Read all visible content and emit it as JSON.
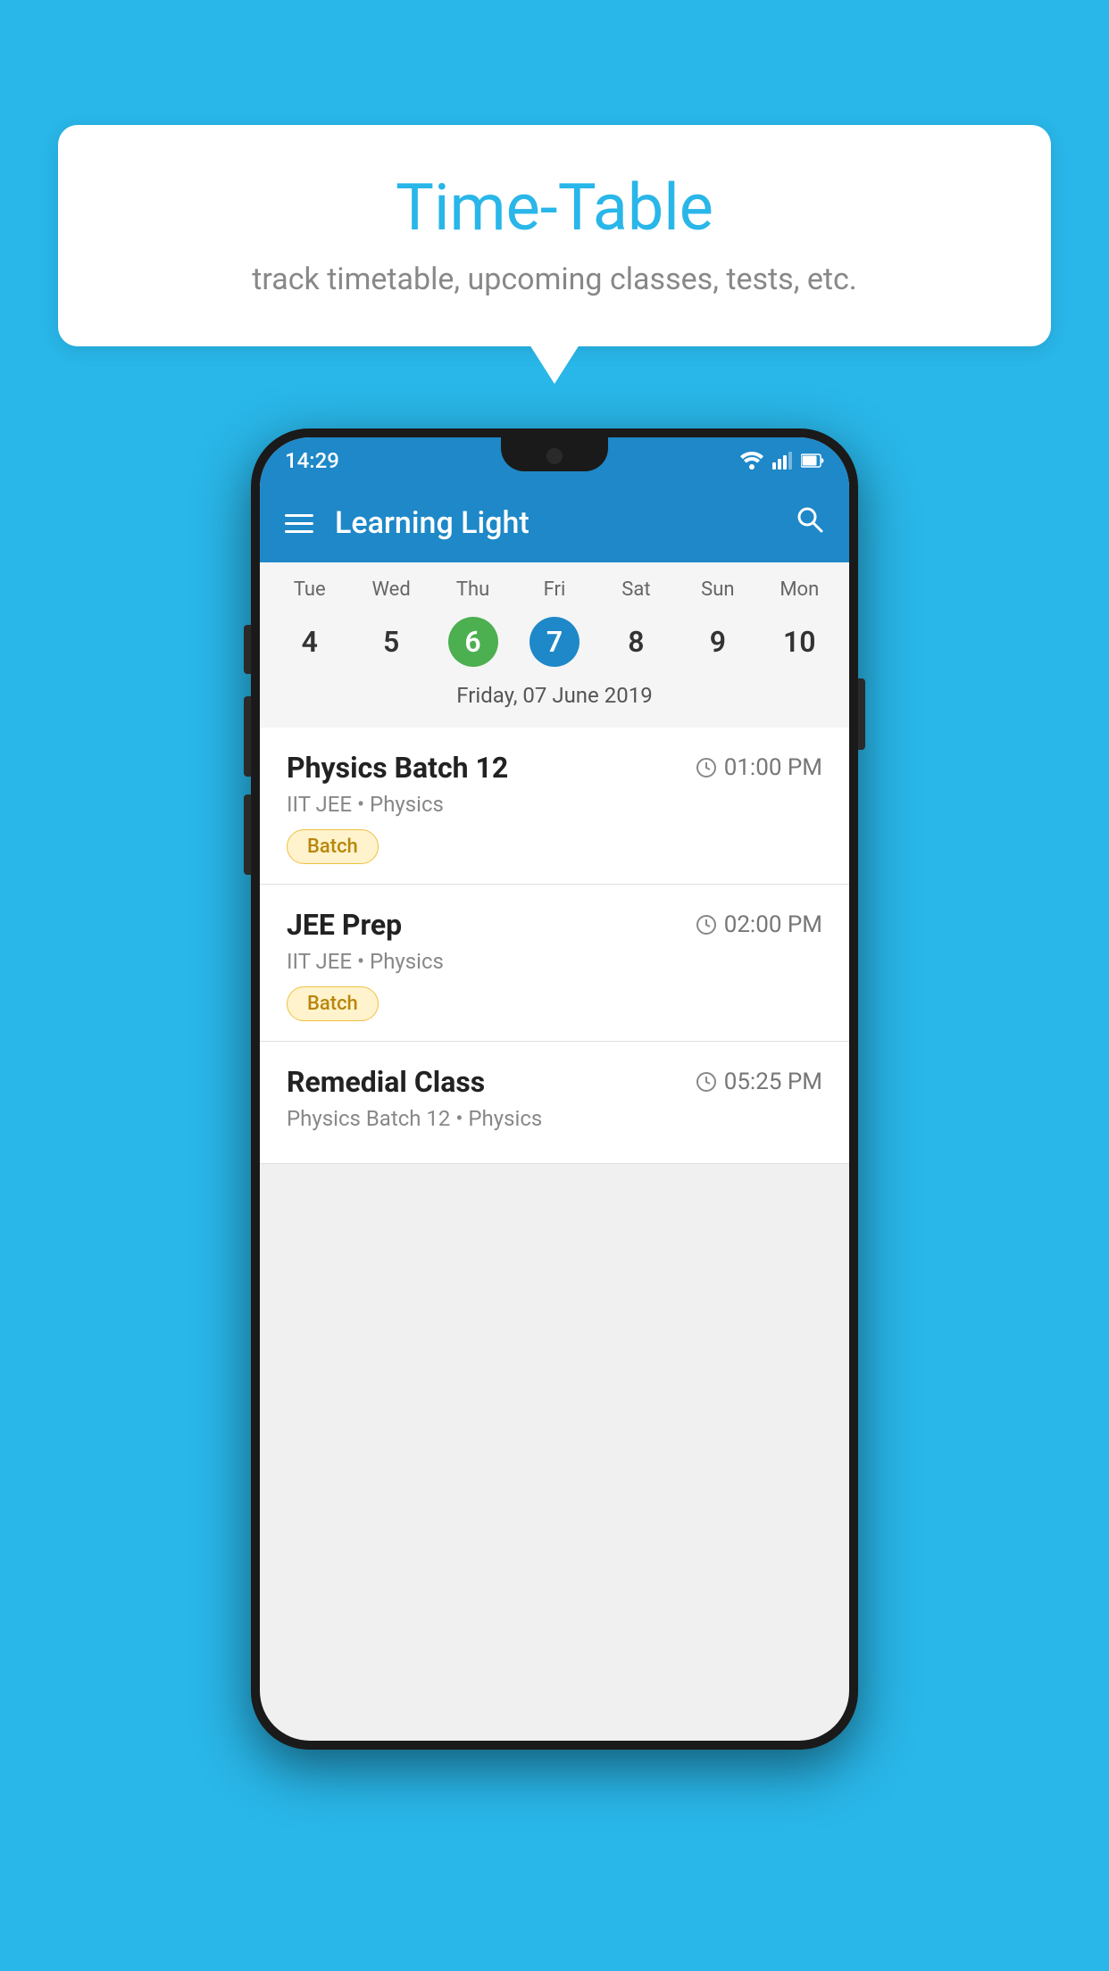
{
  "page": {
    "background_color": "#29b6e8"
  },
  "bubble": {
    "title": "Time-Table",
    "subtitle": "track timetable, upcoming classes, tests, etc."
  },
  "app": {
    "title": "Learning Light"
  },
  "status_bar": {
    "time": "14:29"
  },
  "calendar": {
    "selected_date_label": "Friday, 07 June 2019",
    "days": [
      {
        "name": "Tue",
        "number": "4",
        "state": "normal"
      },
      {
        "name": "Wed",
        "number": "5",
        "state": "normal"
      },
      {
        "name": "Thu",
        "number": "6",
        "state": "today"
      },
      {
        "name": "Fri",
        "number": "7",
        "state": "selected"
      },
      {
        "name": "Sat",
        "number": "8",
        "state": "normal"
      },
      {
        "name": "Sun",
        "number": "9",
        "state": "normal"
      },
      {
        "name": "Mon",
        "number": "10",
        "state": "normal"
      }
    ]
  },
  "schedule_items": [
    {
      "title": "Physics Batch 12",
      "time": "01:00 PM",
      "subtitle": "IIT JEE • Physics",
      "badge": "Batch"
    },
    {
      "title": "JEE Prep",
      "time": "02:00 PM",
      "subtitle": "IIT JEE • Physics",
      "badge": "Batch"
    },
    {
      "title": "Remedial Class",
      "time": "05:25 PM",
      "subtitle": "Physics Batch 12 • Physics",
      "badge": null
    }
  ],
  "icons": {
    "hamburger": "menu-icon",
    "search": "search-icon",
    "clock": "⏱"
  }
}
